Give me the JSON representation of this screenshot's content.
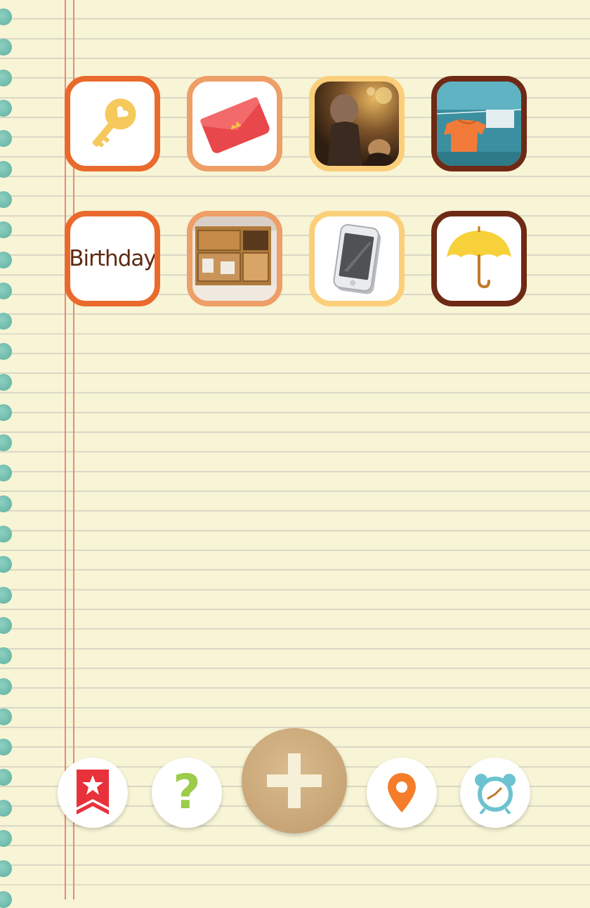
{
  "app_grid": {
    "tiles": [
      {
        "name": "key",
        "icon": "key-icon",
        "border_color": "#e96a2c"
      },
      {
        "name": "wallet",
        "icon": "wallet-icon",
        "border_color": "#ee9e67"
      },
      {
        "name": "figurines-photo",
        "icon": "photo-icon",
        "border_color": "#fbcf7a"
      },
      {
        "name": "laundry-photo",
        "icon": "photo-icon",
        "border_color": "#6e2a14"
      },
      {
        "name": "birthday",
        "label": "Birthday",
        "border_color": "#e96a2c"
      },
      {
        "name": "drawers-photo",
        "icon": "photo-icon",
        "border_color": "#ee9e67"
      },
      {
        "name": "phone",
        "icon": "phone-icon",
        "border_color": "#fbcf7a"
      },
      {
        "name": "umbrella",
        "icon": "umbrella-icon",
        "border_color": "#6e2a14"
      }
    ]
  },
  "dock": {
    "bookmark": {
      "icon": "bookmark-star-icon",
      "color": "#e8313a"
    },
    "help": {
      "label": "?",
      "color": "#9ccc4a"
    },
    "add": {
      "icon": "plus-icon",
      "color": "#c9a878"
    },
    "location": {
      "icon": "location-pin-icon",
      "color": "#f57d2a"
    },
    "alarm": {
      "icon": "alarm-clock-icon",
      "color": "#6cc3cf"
    }
  },
  "theme": {
    "paper": "#f8f4d6",
    "rule_line": "#d9d7c6",
    "margin_line": "#e88a74",
    "binding_hole": "#6fbdad"
  }
}
